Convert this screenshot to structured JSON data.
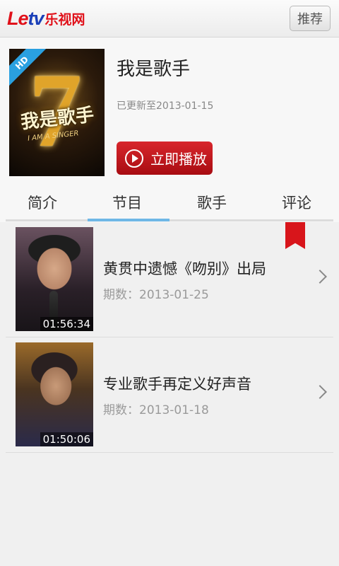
{
  "topbar": {
    "logo_latin_1": "Le",
    "logo_latin_2": "tv",
    "logo_cn": "乐视网",
    "recommend_label": "推荐"
  },
  "show": {
    "poster_number": "7",
    "poster_title": "我是歌手",
    "poster_subtitle": "I AM A SINGER",
    "hd_badge": "HD",
    "title": "我是歌手",
    "updated": "已更新至2013-01-15",
    "play_label": "立即播放"
  },
  "tabs": [
    {
      "label": "简介"
    },
    {
      "label": "节目"
    },
    {
      "label": "歌手"
    },
    {
      "label": "评论"
    }
  ],
  "active_tab": "节目",
  "episodes": [
    {
      "title": "黄贯中遗憾《吻别》出局",
      "date": "期数：2013-01-25",
      "duration": "01:56:34",
      "bookmarked": true
    },
    {
      "title": "专业歌手再定义好声音",
      "date": "期数：2013-01-18",
      "duration": "01:50:06",
      "bookmarked": false
    }
  ],
  "colors": {
    "brand_red": "#e0111a",
    "brand_blue": "#1a3fb8",
    "active_tab": "#6fb7e6",
    "play_button": "#c41a20"
  }
}
